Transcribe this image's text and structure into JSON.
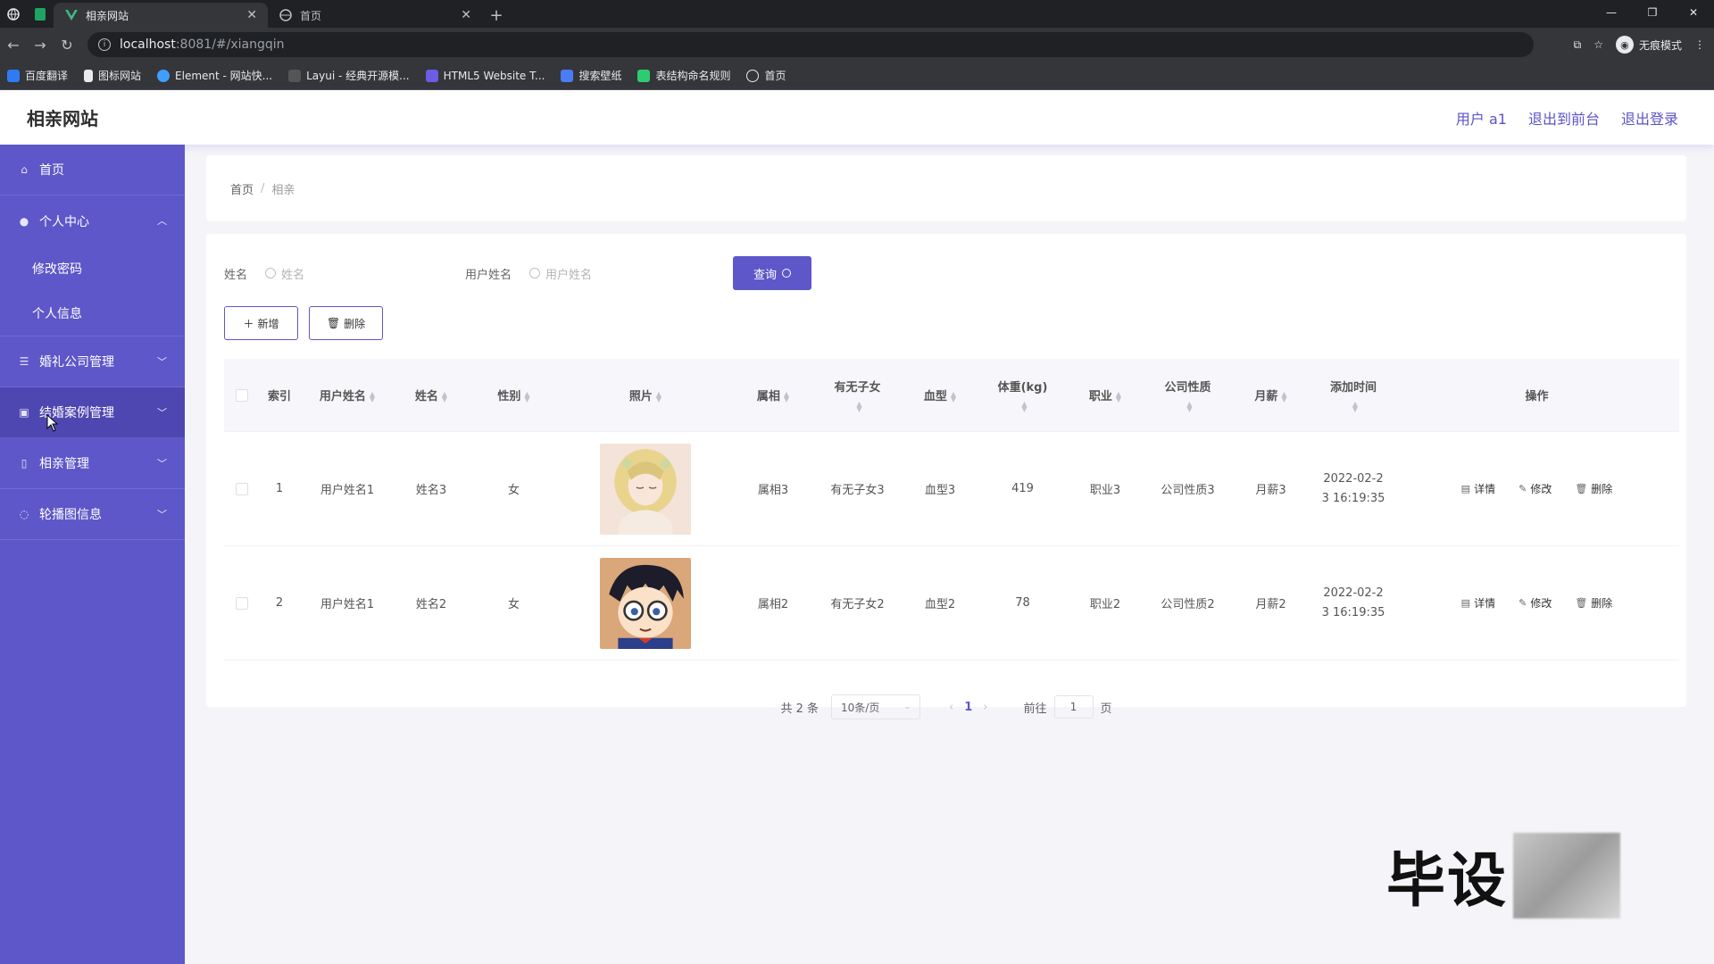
{
  "browser": {
    "tabs": [
      {
        "label": "相亲网站",
        "active": true
      },
      {
        "label": "首页",
        "active": false
      }
    ],
    "url_host": "localhost",
    "url_rest": ":8081/#/xiangqin",
    "incognito_label": "无痕模式",
    "bookmarks": [
      {
        "label": "百度翻译",
        "color": "#2f7bf5"
      },
      {
        "label": "图标网站",
        "color": "#ffffff"
      },
      {
        "label": "Element - 网站快...",
        "color": "#409eff"
      },
      {
        "label": "Layui - 经典开源模...",
        "color": "#2e2e2e"
      },
      {
        "label": "HTML5 Website T...",
        "color": "#6c5ce7"
      },
      {
        "label": "搜索壁纸",
        "color": "#4a7cf5"
      },
      {
        "label": "表结构命名规则",
        "color": "#2ecc71"
      },
      {
        "label": "首页",
        "color": "#e8eaed"
      }
    ]
  },
  "header": {
    "title": "相亲网站",
    "user_label": "用户 a1",
    "front_label": "退出到前台",
    "logout_label": "退出登录"
  },
  "sidebar": {
    "items": [
      {
        "label": "首页",
        "icon": "home-icon"
      },
      {
        "label": "个人中心",
        "icon": "user-icon",
        "expanded": true,
        "children": [
          "修改密码",
          "个人信息"
        ]
      },
      {
        "label": "婚礼公司管理",
        "icon": "list-icon"
      },
      {
        "label": "结婚案例管理",
        "icon": "file-icon"
      },
      {
        "label": "相亲管理",
        "icon": "doc-icon"
      },
      {
        "label": "轮播图信息",
        "icon": "image-icon"
      }
    ]
  },
  "breadcrumb": {
    "home": "首页",
    "current": "相亲"
  },
  "search": {
    "name_label": "姓名",
    "name_placeholder": "姓名",
    "username_label": "用户姓名",
    "username_placeholder": "用户姓名",
    "query_label": "查询"
  },
  "actions": {
    "add_label": "新增",
    "delete_label": "删除"
  },
  "table": {
    "columns": [
      "索引",
      "用户姓名",
      "姓名",
      "性别",
      "照片",
      "属相",
      "有无子女",
      "血型",
      "体重(kg)",
      "职业",
      "公司性质",
      "月薪",
      "添加时间",
      "操作"
    ],
    "rows": [
      {
        "index": "1",
        "username": "用户姓名1",
        "name": "姓名3",
        "gender": "女",
        "zodiac": "属相3",
        "children": "有无子女3",
        "blood": "血型3",
        "weight": "419",
        "job": "职业3",
        "company": "公司性质3",
        "salary": "月薪3",
        "time1": "2022-02-2",
        "time2": "3 16:19:35"
      },
      {
        "index": "2",
        "username": "用户姓名1",
        "name": "姓名2",
        "gender": "女",
        "zodiac": "属相2",
        "children": "有无子女2",
        "blood": "血型2",
        "weight": "78",
        "job": "职业2",
        "company": "公司性质2",
        "salary": "月薪2",
        "time1": "2022-02-2",
        "time2": "3 16:19:35"
      }
    ],
    "ops": {
      "detail": "详情",
      "edit": "修改",
      "delete": "删除"
    }
  },
  "pager": {
    "total": "共 2 条",
    "size": "10条/页",
    "page": "1",
    "goto": "前往",
    "goto_value": "1",
    "unit": "页"
  },
  "watermark": "毕设"
}
